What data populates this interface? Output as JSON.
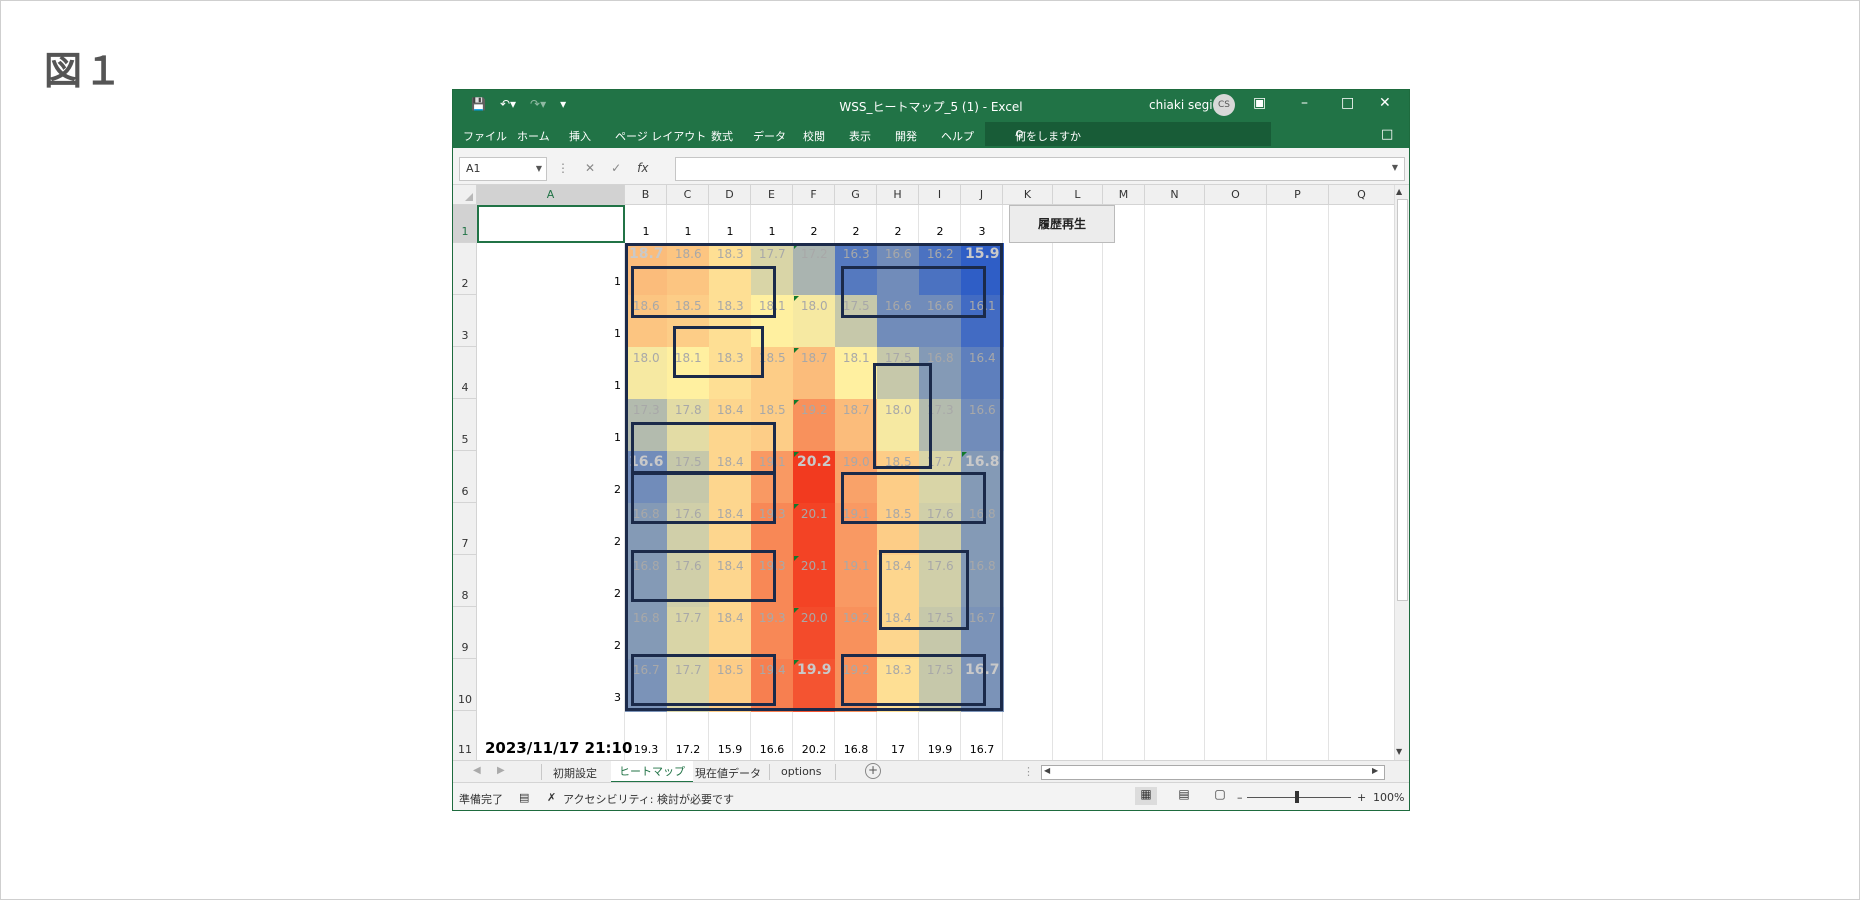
{
  "figure_label": "図１",
  "window": {
    "title": "WSS_ヒートマップ_5 (1)  -  Excel",
    "user_name": "chiaki segi",
    "avatar_initials": "CS"
  },
  "ribbon": {
    "tabs": [
      "ファイル",
      "ホーム",
      "挿入",
      "ページ レイアウト",
      "数式",
      "データ",
      "校閲",
      "表示",
      "開発",
      "ヘルプ"
    ],
    "tell_me": "何をしますか"
  },
  "formula_bar": {
    "name_box": "A1",
    "fx_label": "fx",
    "formula": ""
  },
  "sheet": {
    "columns": [
      "A",
      "B",
      "C",
      "D",
      "E",
      "F",
      "G",
      "H",
      "I",
      "J",
      "K",
      "L",
      "M",
      "N",
      "O",
      "P",
      "Q"
    ],
    "rows": [
      "1",
      "2",
      "3",
      "4",
      "5",
      "6",
      "7",
      "8",
      "9",
      "10",
      "11"
    ],
    "row1_values": [
      "1",
      "1",
      "1",
      "1",
      "2",
      "2",
      "2",
      "2",
      "3"
    ],
    "row_labels": [
      "1",
      "1",
      "1",
      "1",
      "2",
      "2",
      "2",
      "2",
      "3"
    ],
    "button_label": "履歴再生",
    "datestamp": "2023/11/17 21:10",
    "row11_values": [
      "19.3",
      "17.2",
      "15.9",
      "16.6",
      "20.2",
      "16.8",
      "17",
      "19.9",
      "16.7"
    ]
  },
  "heatmap": {
    "grid": [
      [
        "18.7",
        "18.6",
        "18.3",
        "17.7",
        "17.2",
        "16.3",
        "16.6",
        "16.2",
        "15.9"
      ],
      [
        "18.6",
        "18.5",
        "18.3",
        "18.1",
        "18.0",
        "17.5",
        "16.6",
        "16.6",
        "16.1"
      ],
      [
        "18.0",
        "18.1",
        "18.3",
        "18.5",
        "18.7",
        "18.1",
        "17.5",
        "16.8",
        "16.4"
      ],
      [
        "17.3",
        "17.8",
        "18.4",
        "18.5",
        "19.2",
        "18.7",
        "18.0",
        "17.3",
        "16.6"
      ],
      [
        "16.6",
        "17.5",
        "18.4",
        "19.1",
        "20.2",
        "19.0",
        "18.5",
        "17.7",
        "16.8"
      ],
      [
        "16.8",
        "17.6",
        "18.4",
        "19.3",
        "20.1",
        "19.1",
        "18.5",
        "17.6",
        "16.8"
      ],
      [
        "16.8",
        "17.6",
        "18.4",
        "19.3",
        "20.1",
        "19.1",
        "18.4",
        "17.6",
        "16.8"
      ],
      [
        "16.8",
        "17.7",
        "18.4",
        "19.3",
        "20.0",
        "19.2",
        "18.4",
        "17.5",
        "16.7"
      ],
      [
        "16.7",
        "17.7",
        "18.5",
        "19.4",
        "19.9",
        "19.2",
        "18.3",
        "17.5",
        "16.7"
      ]
    ],
    "bold_cells": [
      [
        0,
        0
      ],
      [
        0,
        8
      ],
      [
        4,
        0
      ],
      [
        4,
        4
      ],
      [
        4,
        8
      ],
      [
        8,
        4
      ],
      [
        8,
        8
      ]
    ],
    "colors": {
      "low": "#2f5ec6",
      "mid": "#fff0a0",
      "high": "#f23a1f",
      "border": "#1b2a4a",
      "text": "#a8a8a8"
    },
    "scale": [
      15.9,
      18.1,
      20.2
    ]
  },
  "sheet_tabs": [
    "初期設定",
    "ヒートマップ",
    "現在値データ",
    "options"
  ],
  "active_tab": "ヒートマップ",
  "status": {
    "ready": "準備完了",
    "accessibility": "アクセシビリティ: 検討が必要です",
    "zoom_label": "100%"
  },
  "icons": {
    "save": "floppy-icon",
    "undo": "undo-icon",
    "redo": "redo-icon"
  }
}
